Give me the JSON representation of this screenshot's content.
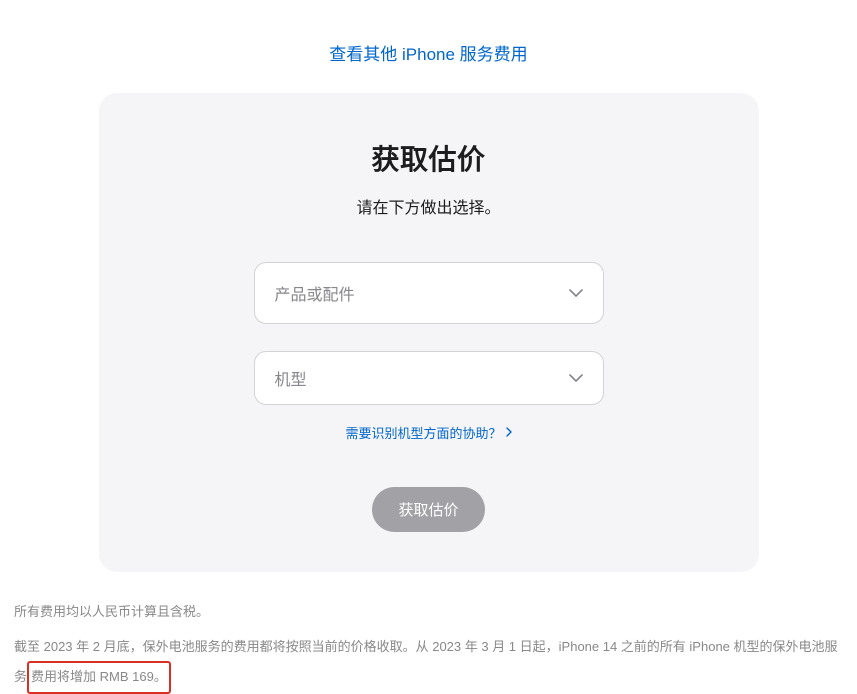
{
  "topLink": {
    "label": "查看其他 iPhone 服务费用"
  },
  "card": {
    "title": "获取估价",
    "subtitle": "请在下方做出选择。",
    "select1": {
      "placeholder": "产品或配件"
    },
    "select2": {
      "placeholder": "机型"
    },
    "helpLink": {
      "label": "需要识别机型方面的协助？"
    },
    "submit": {
      "label": "获取估价"
    }
  },
  "footer": {
    "line1": "所有费用均以人民币计算且含税。",
    "line2_part1": "截至 2023 年 2 月底，保外电池服务的费用都将按照当前的价格收取。从 2023 年 3 月 1 日起，iPhone 14 之前的所有 iPhone 机型的保外电池服务",
    "line2_part2": "费用将增加 RMB 169。"
  }
}
